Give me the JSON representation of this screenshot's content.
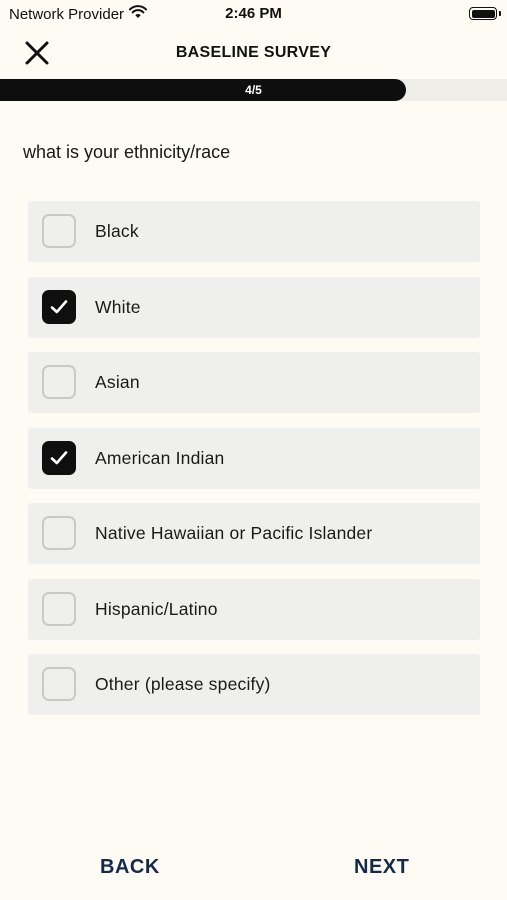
{
  "status_bar": {
    "carrier": "Network Provider",
    "time": "2:46 PM"
  },
  "header": {
    "title": "BASELINE SURVEY"
  },
  "progress": {
    "label": "4/5",
    "fraction": 0.8
  },
  "question": "what is your ethnicity/race",
  "options": [
    {
      "label": "Black",
      "checked": false
    },
    {
      "label": "White",
      "checked": true
    },
    {
      "label": "Asian",
      "checked": false
    },
    {
      "label": "American Indian",
      "checked": true
    },
    {
      "label": "Native Hawaiian or Pacific Islander",
      "checked": false
    },
    {
      "label": "Hispanic/Latino",
      "checked": false
    },
    {
      "label": "Other (please specify)",
      "checked": false
    }
  ],
  "nav": {
    "back_label": "BACK",
    "next_label": "NEXT"
  },
  "colors": {
    "background": "#fdfbf3",
    "accent": "#0f0f0f",
    "nav_text": "#16294a"
  },
  "icons": {
    "close": "close-icon",
    "check": "checkmark-icon",
    "wifi": "wifi-icon",
    "battery": "battery-icon"
  }
}
